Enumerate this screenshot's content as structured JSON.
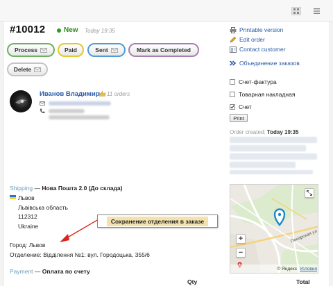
{
  "order": {
    "number": "#10012",
    "status": "New",
    "time": "Today 19:35"
  },
  "actions": {
    "process": "Process",
    "paid": "Paid",
    "sent": "Sent",
    "completed": "Mark as Completed",
    "delete": "Delete"
  },
  "customer": {
    "name": "Иванов Владимир",
    "orders_count": "11 orders"
  },
  "shipping": {
    "label": "Shipping",
    "dash": "—",
    "method": "Нова Пошта 2.0 (До склада)",
    "address": [
      "Львов",
      "Львівська область",
      "112312",
      "Ukraine"
    ],
    "city": "Город: Львов",
    "branch": "Отделение: Відділення №1: вул. Городоцька, 355/6"
  },
  "callout": "Сохранение отделения в заказе",
  "payment": {
    "label": "Payment",
    "dash": "—",
    "method": "Оплата по счету"
  },
  "items_table": {
    "qty": "Qty",
    "total": "Total"
  },
  "sidebar": {
    "links": {
      "printable": "Printable version",
      "edit": "Edit order",
      "contact": "Contact customer",
      "merge": "Объединение заказов"
    },
    "documents": [
      {
        "label": "Счет-фактура",
        "checked": false
      },
      {
        "label": "Товарная накладная",
        "checked": false
      },
      {
        "label": "Счет",
        "checked": true
      }
    ],
    "print": "Print",
    "order_created_label": "Order created:",
    "order_created_value": "Today 19:35"
  },
  "map": {
    "street": "Пекарская ул",
    "attribution": "© Яндекс",
    "terms": "Условия"
  },
  "colors": {
    "process": "#6ab25c",
    "paid": "#e3c92c",
    "sent": "#4e9bd6",
    "completed": "#a77fb4",
    "link": "#2a5ba8",
    "status_new": "#2e8b1e",
    "callout_bg": "#f3e2ad",
    "arrow": "#d9261c"
  },
  "icons": {
    "view_grid": "grid-view-icon",
    "view_list": "list-view-icon",
    "envelope": "envelope-icon",
    "crown": "crown-icon",
    "mail": "mail-icon",
    "phone": "phone-icon",
    "printer": "printer-icon",
    "pencil": "pencil-icon",
    "contact": "contact-icon",
    "merge": "merge-arrow-icon"
  }
}
